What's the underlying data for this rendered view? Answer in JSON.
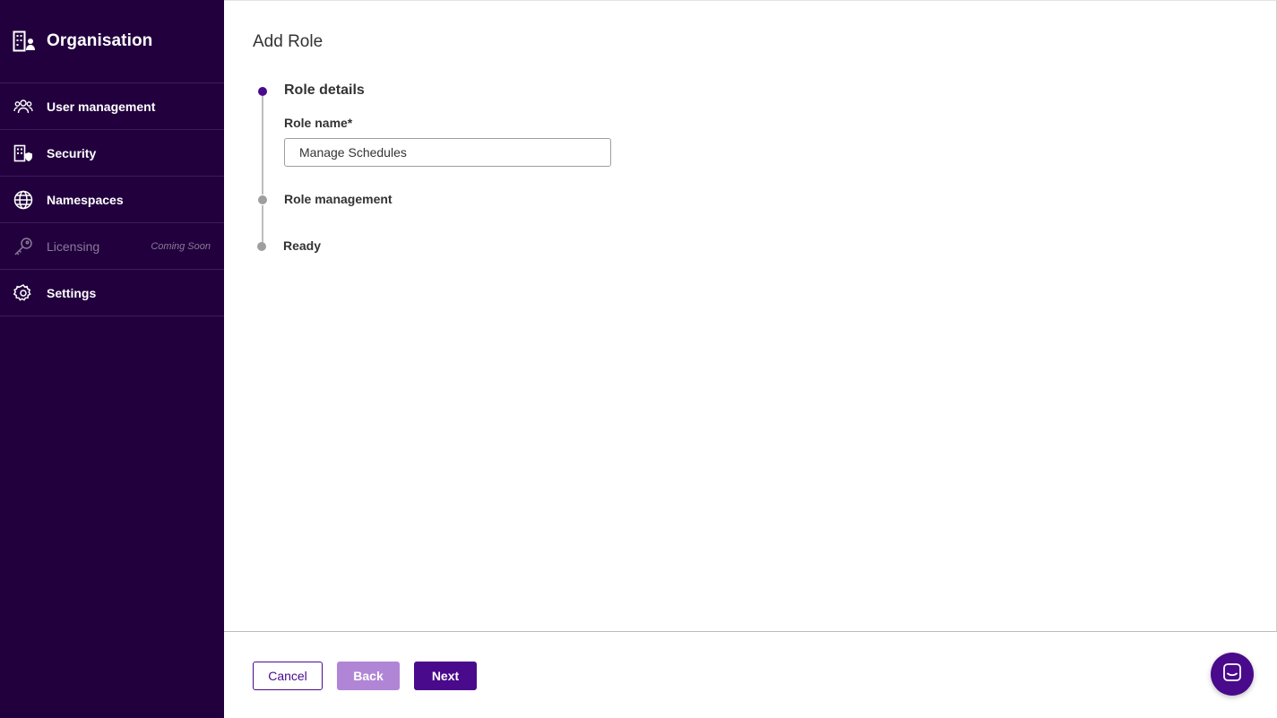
{
  "sidebar": {
    "title": "Organisation",
    "items": [
      {
        "label": "User management",
        "icon": "users-icon"
      },
      {
        "label": "Security",
        "icon": "building-shield-icon"
      },
      {
        "label": "Namespaces",
        "icon": "globe-icon"
      },
      {
        "label": "Licensing",
        "icon": "key-icon",
        "badge": "Coming Soon",
        "disabled": true
      },
      {
        "label": "Settings",
        "icon": "gear-icon"
      }
    ]
  },
  "page": {
    "title": "Add Role"
  },
  "stepper": {
    "steps": [
      {
        "label": "Role details",
        "active": true
      },
      {
        "label": "Role management"
      },
      {
        "label": "Ready"
      }
    ],
    "role_name": {
      "label": "Role name*",
      "value": "Manage Schedules"
    }
  },
  "footer": {
    "cancel_label": "Cancel",
    "back_label": "Back",
    "next_label": "Next"
  },
  "colors": {
    "sidebar_bg": "#22003e",
    "primary": "#4a0a8c",
    "primary_disabled": "#b185d6"
  }
}
